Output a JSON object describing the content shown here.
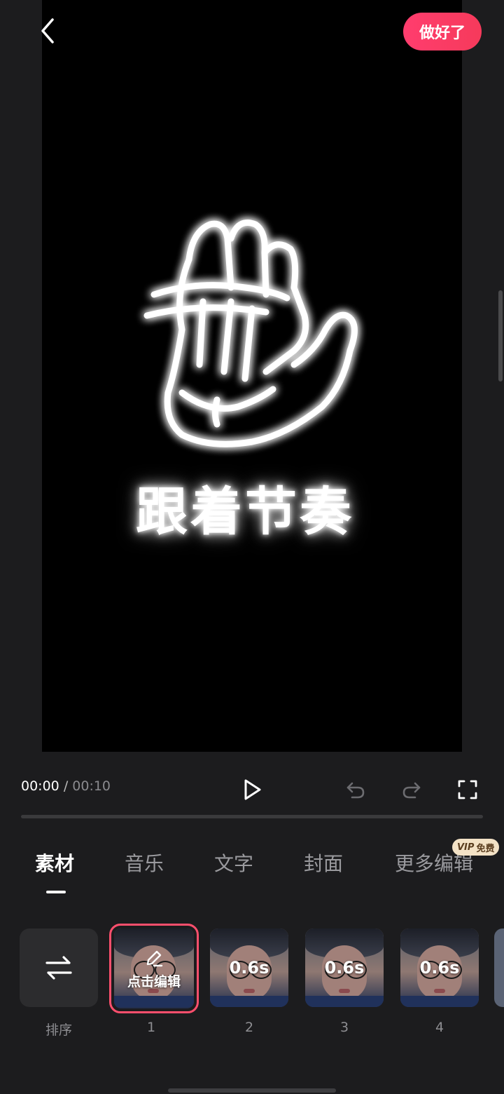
{
  "header": {
    "done_label": "做好了"
  },
  "preview": {
    "overlay_text": "跟着节奏"
  },
  "player": {
    "current_time": "00:00",
    "separator": "/",
    "duration": "00:10"
  },
  "tabs": [
    {
      "label": "素材",
      "active": true
    },
    {
      "label": "音乐"
    },
    {
      "label": "文字"
    },
    {
      "label": "封面"
    },
    {
      "label": "更多编辑"
    }
  ],
  "vip_badge": {
    "vip": "VIP",
    "free": "免费"
  },
  "sort": {
    "label": "排序"
  },
  "clips": [
    {
      "number": "1",
      "edit_label": "点击编辑"
    },
    {
      "number": "2",
      "duration": "0.6s"
    },
    {
      "number": "3",
      "duration": "0.6s"
    },
    {
      "number": "4",
      "duration": "0.6s"
    }
  ],
  "colors": {
    "accent": "#ff3d6e",
    "background": "#1c1c1e"
  }
}
